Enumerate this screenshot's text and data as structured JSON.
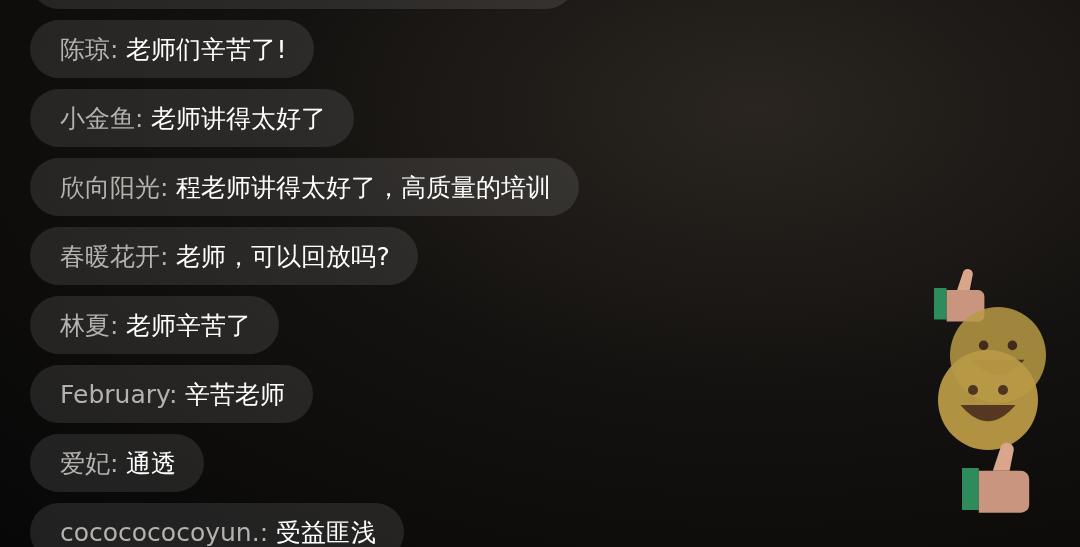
{
  "chat": {
    "messages": [
      {
        "name": "陈琼:",
        "text": "老师们辛苦了!"
      },
      {
        "name": "小金鱼:",
        "text": "老师讲得太好了"
      },
      {
        "name": "欣向阳光:",
        "text": "程老师讲得太好了，高质量的培训"
      },
      {
        "name": "春暖花开:",
        "text": "老师，可以回放吗?"
      },
      {
        "name": "林夏:",
        "text": "老师辛苦了"
      },
      {
        "name": "February:",
        "text": "辛苦老师"
      },
      {
        "name": "爱妃:",
        "text": "通透"
      },
      {
        "name": "cococococoyun.:",
        "text": "受益匪浅"
      }
    ]
  }
}
